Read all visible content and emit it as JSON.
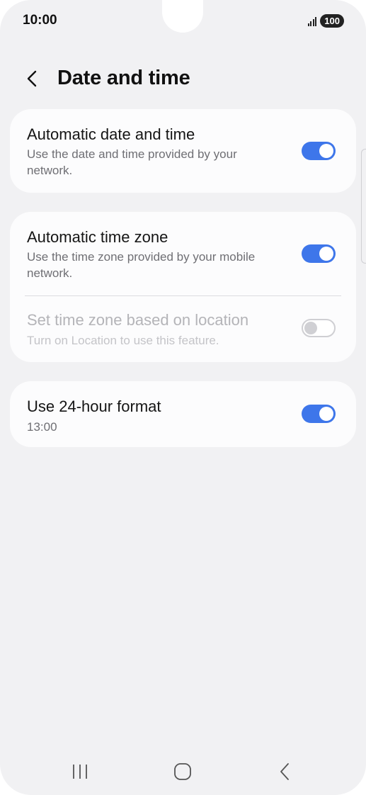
{
  "status_bar": {
    "time": "10:00",
    "battery": "100",
    "signal_icon": "signal-icon"
  },
  "header": {
    "title": "Date and time",
    "back_icon": "chevron-left-icon"
  },
  "settings": {
    "automatic_date_time": {
      "title": "Automatic date and time",
      "subtitle": "Use the date and time provided by your network.",
      "enabled": true
    },
    "automatic_time_zone": {
      "title": "Automatic time zone",
      "subtitle": "Use the time zone provided by your mobile network.",
      "enabled": true
    },
    "time_zone_location": {
      "title": "Set time zone based on location",
      "subtitle": "Turn on Location to use this feature.",
      "enabled": false,
      "disabled": true
    },
    "use_24_hour": {
      "title": "Use 24-hour format",
      "subtitle": "13:00",
      "enabled": true
    }
  },
  "colors": {
    "toggle_on": "#3e76ea",
    "background": "#f1f1f3",
    "card": "#fcfcfd"
  },
  "nav_bar": {
    "recents_icon": "recents-icon",
    "home_icon": "home-icon",
    "back_icon": "back-icon"
  }
}
